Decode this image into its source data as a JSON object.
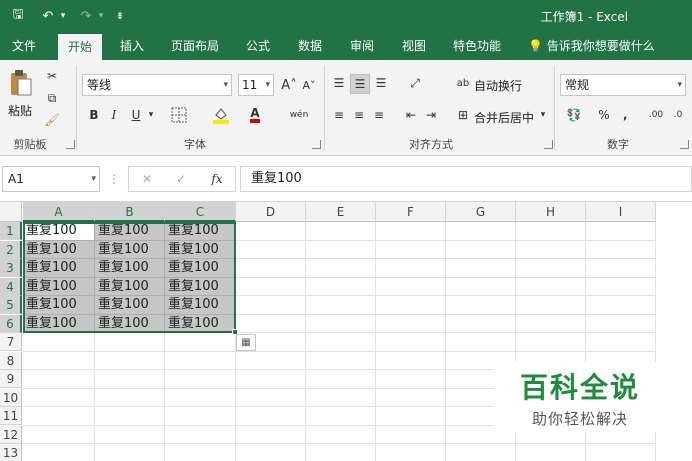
{
  "app": {
    "title": "工作簿1 - Excel"
  },
  "quick_access": {
    "save": "🖫",
    "undo": "↶",
    "undo_dd": "▾",
    "redo": "↷",
    "redo_dd": "▾",
    "customize": "⇟"
  },
  "menu": {
    "tabs": [
      "文件",
      "开始",
      "插入",
      "页面布局",
      "公式",
      "数据",
      "审阅",
      "视图",
      "特色功能"
    ],
    "active_tab": "开始",
    "tell_me": "告诉我你想要做什么"
  },
  "ribbon": {
    "clipboard": {
      "paste": "粘贴",
      "label": "剪贴板"
    },
    "font": {
      "name": "等线",
      "size": "11",
      "bold": "B",
      "italic": "I",
      "underline": "U",
      "grow": "A˄",
      "shrink": "A˅",
      "font_color": "A",
      "phonetic": "wén",
      "label": "字体"
    },
    "alignment": {
      "wrap_text": "自动换行",
      "merge_center": "合并后居中",
      "label": "对齐方式"
    },
    "number": {
      "format": "常规",
      "percent": "%",
      "comma": "‚",
      "inc_decimal": ".00",
      "dec_decimal": ".0",
      "label": "数字"
    }
  },
  "formula_bar": {
    "name_box": "A1",
    "cancel": "✕",
    "enter": "✓",
    "fx": "fx",
    "content": "重复100"
  },
  "sheet": {
    "columns": [
      "A",
      "B",
      "C",
      "D",
      "E",
      "F",
      "G",
      "H",
      "I"
    ],
    "rows": [
      "1",
      "2",
      "3",
      "4",
      "5",
      "6",
      "7",
      "8",
      "9",
      "10",
      "11",
      "12",
      "13"
    ],
    "cells": [
      [
        "重复100",
        "重复100",
        "重复100"
      ],
      [
        "重复100",
        "重复100",
        "重复100"
      ],
      [
        "重复100",
        "重复100",
        "重复100"
      ],
      [
        "重复100",
        "重复100",
        "重复100"
      ],
      [
        "重复100",
        "重复100",
        "重复100"
      ],
      [
        "重复100",
        "重复100",
        "重复100"
      ]
    ],
    "selected_range": "A1:C6",
    "active_cell": "A1"
  },
  "watermark": {
    "title": "百科全说",
    "subtitle": "助你轻松解决"
  },
  "colors": {
    "brand": "#217346",
    "selection_fill": "#c6c6c6",
    "watermark": "#1e8c3a"
  }
}
